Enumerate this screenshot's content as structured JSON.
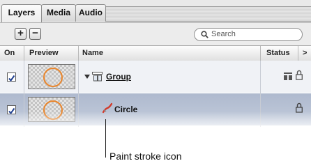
{
  "tabs": [
    {
      "label": "Layers",
      "active": true
    },
    {
      "label": "Media",
      "active": false
    },
    {
      "label": "Audio",
      "active": false
    }
  ],
  "toolbar": {
    "add_label": "+",
    "remove_label": "−",
    "search_placeholder": "Search"
  },
  "columns": {
    "on": "On",
    "preview": "Preview",
    "name": "Name",
    "status": "Status",
    "more": ">"
  },
  "rows": [
    {
      "name": "Group",
      "checked": true,
      "icon": "group-icon"
    },
    {
      "name": "Circle",
      "checked": true,
      "icon": "paint-stroke-icon"
    }
  ],
  "callout": {
    "text": "Paint stroke icon"
  },
  "colors": {
    "selected_row": "#b9c3d6",
    "thumbnail_circle": "#e9852b",
    "paint_stroke_red": "#d23a2a"
  }
}
